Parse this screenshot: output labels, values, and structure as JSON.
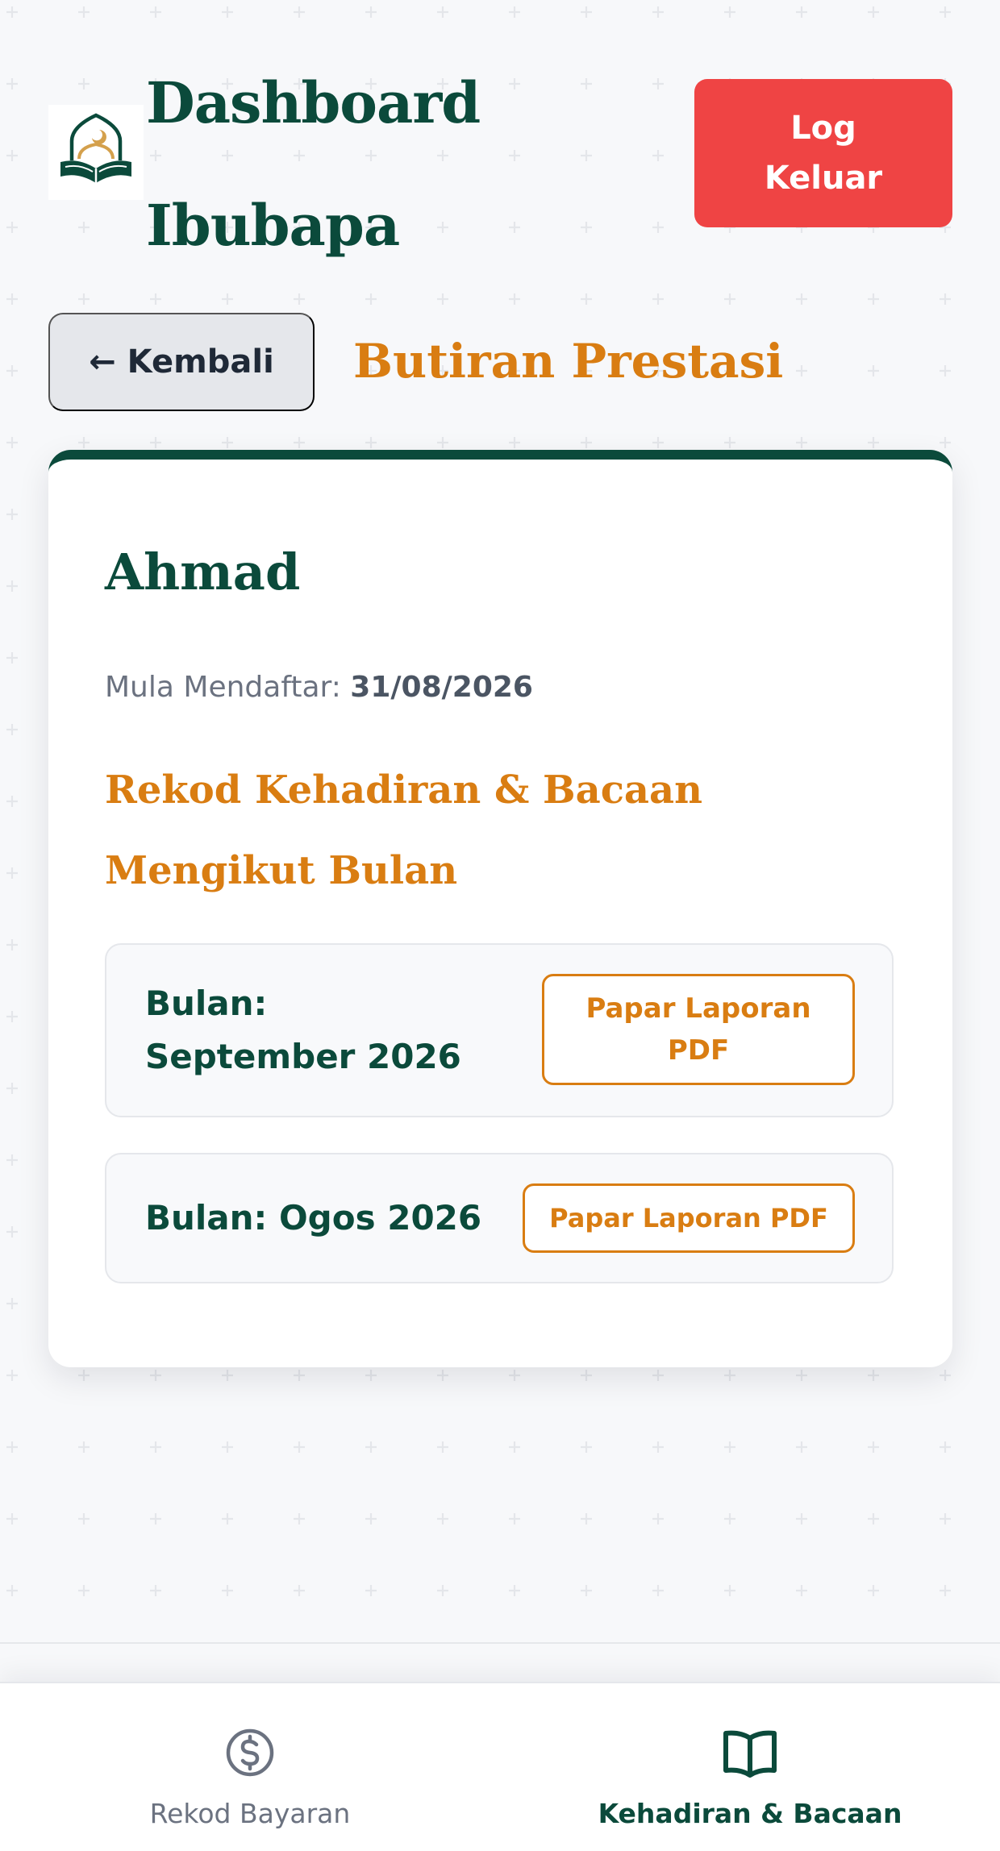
{
  "header": {
    "title": "Dashboard Ibubapa",
    "logout_label": "Log Keluar"
  },
  "back_label": "← Kembali",
  "section_title": "Butiran Prestasi",
  "student": {
    "name": "Ahmad",
    "enrol_label": "Mula Mendaftar:",
    "enrol_date": "31/08/2026"
  },
  "records": {
    "heading": "Rekod Kehadiran & Bacaan Mengikut Bulan",
    "months": [
      {
        "label": "Bulan: September 2026",
        "button_label": "Papar Laporan PDF"
      },
      {
        "label": "Bulan: Ogos 2026",
        "button_label": "Papar Laporan PDF"
      }
    ]
  },
  "bottom_nav": {
    "items": [
      {
        "label": "Rekod Bayaran",
        "icon": "dollar-circle-icon",
        "active": false
      },
      {
        "label": "Kehadiran & Bacaan",
        "icon": "open-book-icon",
        "active": true
      }
    ]
  },
  "colors": {
    "brand_green": "#0b4a3b",
    "accent_orange": "#d97d12",
    "logout_red": "#ef4444",
    "background": "#f7f8fa"
  }
}
